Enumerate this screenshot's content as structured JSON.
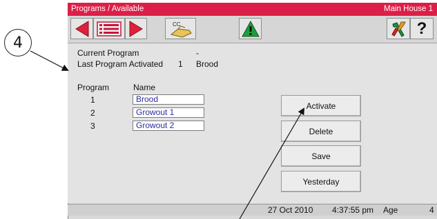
{
  "callout_number": "4",
  "titlebar": {
    "title": "Programs / Available",
    "house": "Main House 1"
  },
  "toolbar": {
    "buttons": [
      {
        "icon": "arrow-left-icon"
      },
      {
        "icon": "list-icon"
      },
      {
        "icon": "arrow-right-icon"
      },
      {
        "icon": "cc-hand-icon",
        "text": "CC"
      },
      {
        "icon": "warning-icon"
      },
      {
        "icon": "tools-icon"
      },
      {
        "icon": "help-icon",
        "text": "?"
      }
    ]
  },
  "info": {
    "current_program_label": "Current Program",
    "current_program_value": "-",
    "last_activated_label": "Last Program Activated",
    "last_activated_number": "1",
    "last_activated_name": "Brood"
  },
  "programs": {
    "header_program": "Program",
    "header_name": "Name",
    "rows": [
      {
        "number": "1",
        "name": "Brood"
      },
      {
        "number": "2",
        "name": "Growout 1"
      },
      {
        "number": "3",
        "name": "Growout 2"
      }
    ]
  },
  "actions": {
    "activate": "Activate",
    "delete": "Delete",
    "save": "Save",
    "yesterday": "Yesterday"
  },
  "status": {
    "date": "27 Oct 2010",
    "time": "4:37:55 pm",
    "age_label": "Age",
    "age_value": "4"
  },
  "colors": {
    "titlebar": "#dc1f48",
    "arrow_red": "#e0203a",
    "warning_green": "#1f9e3a"
  }
}
